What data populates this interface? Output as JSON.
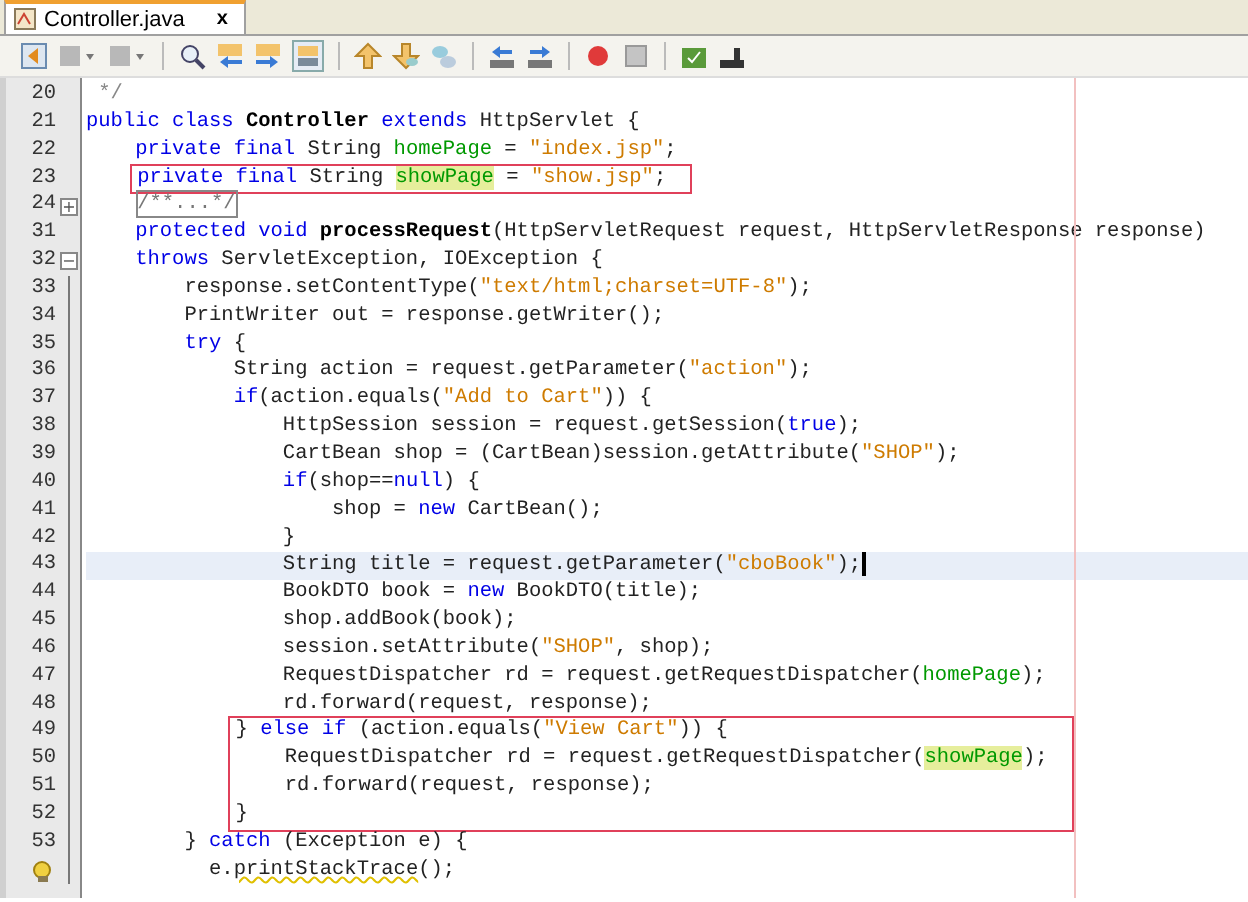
{
  "tab": {
    "title": "Controller.java",
    "close": "x",
    "selected": true
  },
  "blocks": [
    {
      "lines": [
        {
          "number": "20",
          "tokens": [
            {
              "text": " */",
              "kind": "comment"
            }
          ]
        },
        {
          "number": "21",
          "tokens": [
            {
              "text": "public class ",
              "kind": "keyword"
            },
            {
              "text": "Controller",
              "kind": "bold"
            },
            {
              "text": " extends ",
              "kind": "keyword"
            },
            {
              "text": "HttpServlet {",
              "kind": "plain"
            }
          ]
        },
        {
          "number": "22",
          "tokens": [
            {
              "text": "    private final ",
              "kind": "keyword"
            },
            {
              "text": "String ",
              "kind": "plain"
            },
            {
              "text": "homePage",
              "kind": "field"
            },
            {
              "text": " = ",
              "kind": "plain"
            },
            {
              "text": "\"index.jsp\"",
              "kind": "string"
            },
            {
              "text": ";",
              "kind": "plain"
            }
          ]
        }
      ]
    },
    {
      "boxed": true,
      "lines": [
        {
          "number": "23",
          "tokens": [
            {
              "text": "    private final ",
              "kind": "keyword"
            },
            {
              "text": "String ",
              "kind": "plain"
            },
            {
              "text": "showPage",
              "kind": "marked"
            },
            {
              "text": " = ",
              "kind": "plain"
            },
            {
              "text": "\"show.jsp\"",
              "kind": "string"
            },
            {
              "text": ";",
              "kind": "plain"
            }
          ]
        }
      ]
    },
    {
      "lines": [
        {
          "number": "24",
          "fold": "+",
          "tokens": [
            {
              "text": "    /**...*/",
              "kind": "folded"
            }
          ]
        },
        {
          "number": "31",
          "tokens": [
            {
              "text": "    protected void ",
              "kind": "keyword"
            },
            {
              "text": "processRequest",
              "kind": "bold"
            },
            {
              "text": "(HttpServletRequest request, HttpServletResponse response)",
              "kind": "plain"
            }
          ]
        },
        {
          "number": "32",
          "fold": "−",
          "tokens": [
            {
              "text": "    throws ",
              "kind": "keyword"
            },
            {
              "text": "ServletException, IOException {",
              "kind": "plain"
            }
          ]
        },
        {
          "number": "33",
          "tokens": [
            {
              "text": "        response.setContentType(",
              "kind": "plain"
            },
            {
              "text": "\"text/html;charset=UTF-8\"",
              "kind": "string"
            },
            {
              "text": ");",
              "kind": "plain"
            }
          ]
        },
        {
          "number": "34",
          "tokens": [
            {
              "text": "        PrintWriter out = response.getWriter();",
              "kind": "plain"
            }
          ]
        },
        {
          "number": "35",
          "tokens": [
            {
              "text": "        try",
              "kind": "keyword"
            },
            {
              "text": " {",
              "kind": "plain"
            }
          ]
        },
        {
          "number": "36",
          "tokens": [
            {
              "text": "            String action = request.getParameter(",
              "kind": "plain"
            },
            {
              "text": "\"action\"",
              "kind": "string"
            },
            {
              "text": ");",
              "kind": "plain"
            }
          ]
        },
        {
          "number": "37",
          "tokens": [
            {
              "text": "            if",
              "kind": "keyword"
            },
            {
              "text": "(action.equals(",
              "kind": "plain"
            },
            {
              "text": "\"Add to Cart\"",
              "kind": "string"
            },
            {
              "text": ")) {",
              "kind": "plain"
            }
          ]
        },
        {
          "number": "38",
          "tokens": [
            {
              "text": "                HttpSession session = request.getSession(",
              "kind": "plain"
            },
            {
              "text": "true",
              "kind": "keyword"
            },
            {
              "text": ");",
              "kind": "plain"
            }
          ]
        },
        {
          "number": "39",
          "tokens": [
            {
              "text": "                CartBean shop = (CartBean)session.getAttribute(",
              "kind": "plain"
            },
            {
              "text": "\"SHOP\"",
              "kind": "string"
            },
            {
              "text": ");",
              "kind": "plain"
            }
          ]
        },
        {
          "number": "40",
          "tokens": [
            {
              "text": "                if",
              "kind": "keyword"
            },
            {
              "text": "(shop==",
              "kind": "plain"
            },
            {
              "text": "null",
              "kind": "keyword"
            },
            {
              "text": ") {",
              "kind": "plain"
            }
          ]
        },
        {
          "number": "41",
          "tokens": [
            {
              "text": "                    shop = ",
              "kind": "plain"
            },
            {
              "text": "new",
              "kind": "keyword"
            },
            {
              "text": " CartBean();",
              "kind": "plain"
            }
          ]
        },
        {
          "number": "42",
          "tokens": [
            {
              "text": "                }",
              "kind": "plain"
            }
          ]
        },
        {
          "number": "43",
          "current": true,
          "caret": true,
          "tokens": [
            {
              "text": "                String title = request.getParameter(",
              "kind": "plain"
            },
            {
              "text": "\"cboBook\"",
              "kind": "string"
            },
            {
              "text": ");",
              "kind": "plain"
            }
          ]
        },
        {
          "number": "44",
          "tokens": [
            {
              "text": "                BookDTO book = ",
              "kind": "plain"
            },
            {
              "text": "new",
              "kind": "keyword"
            },
            {
              "text": " BookDTO(title);",
              "kind": "plain"
            }
          ]
        },
        {
          "number": "45",
          "tokens": [
            {
              "text": "                shop.addBook(book);",
              "kind": "plain"
            }
          ]
        },
        {
          "number": "46",
          "tokens": [
            {
              "text": "                session.setAttribute(",
              "kind": "plain"
            },
            {
              "text": "\"SHOP\"",
              "kind": "string"
            },
            {
              "text": ", shop);",
              "kind": "plain"
            }
          ]
        },
        {
          "number": "47",
          "tokens": [
            {
              "text": "                RequestDispatcher rd = request.getRequestDispatcher(",
              "kind": "plain"
            },
            {
              "text": "homePage",
              "kind": "field"
            },
            {
              "text": ");",
              "kind": "plain"
            }
          ]
        },
        {
          "number": "48",
          "tokens": [
            {
              "text": "                rd.forward(request, response);",
              "kind": "plain"
            }
          ]
        }
      ]
    },
    {
      "boxed": true,
      "lines": [
        {
          "number": "49",
          "tokens": [
            {
              "text": "            } ",
              "kind": "plain"
            },
            {
              "text": "else if",
              "kind": "keyword"
            },
            {
              "text": " (action.equals(",
              "kind": "plain"
            },
            {
              "text": "\"View Cart\"",
              "kind": "string"
            },
            {
              "text": ")) {",
              "kind": "plain"
            }
          ]
        },
        {
          "number": "50",
          "tokens": [
            {
              "text": "                RequestDispatcher rd = request.getRequestDispatcher(",
              "kind": "plain"
            },
            {
              "text": "showPage",
              "kind": "marked"
            },
            {
              "text": ");",
              "kind": "plain"
            }
          ]
        },
        {
          "number": "51",
          "tokens": [
            {
              "text": "                rd.forward(request, response);",
              "kind": "plain"
            }
          ]
        },
        {
          "number": "52",
          "tokens": [
            {
              "text": "            }",
              "kind": "plain"
            }
          ]
        }
      ]
    },
    {
      "lines": [
        {
          "number": "53",
          "tokens": [
            {
              "text": "        } ",
              "kind": "plain"
            },
            {
              "text": "catch",
              "kind": "keyword"
            },
            {
              "text": " (Exception e) {",
              "kind": "plain"
            }
          ]
        },
        {
          "hint": true,
          "tokens": [
            {
              "text": "          e.",
              "kind": "plain"
            },
            {
              "text": "printStackTrace",
              "kind": "warning"
            },
            {
              "text": "();",
              "kind": "plain"
            }
          ]
        }
      ]
    }
  ]
}
